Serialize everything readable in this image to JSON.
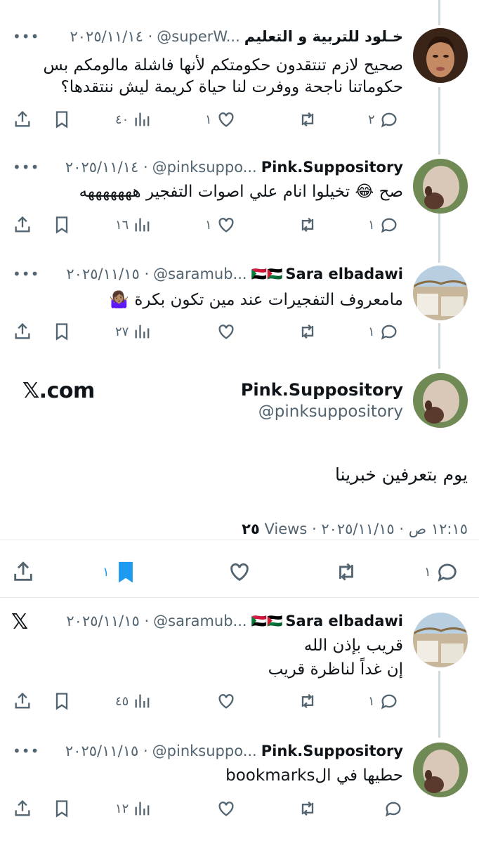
{
  "tweets": [
    {
      "name": "خـلود للتربية و التعليم",
      "handle": "@superW...",
      "date": "٢٠٢٥/١١/١٤ ·",
      "text": "صحيح لازم تنتقدون حكومتكم لأنها فاشلة مالومكم بس حكوماتنا ناجحة ووفرت لنا حياة كريمة ليش ننتقدها؟",
      "replies": "٢",
      "retweets": "",
      "likes": "١",
      "views": "٤٠"
    },
    {
      "name": "Pink.Suppository",
      "handle": "@pinksuppo...",
      "date": "٢٠٢٥/١١/١٤ ·",
      "text": "صح 😂 تخيلوا انام علي اصوات التفجير هههههههه",
      "replies": "١",
      "retweets": "",
      "likes": "١",
      "views": "١٦"
    },
    {
      "name": "Sara elbadawi",
      "flags": "🇸🇩🇵🇸",
      "handle": "@saramub...",
      "date": "٢٠٢٥/١١/١٥ ·",
      "text": "مامعروف التفجيرات عند مين تكون بكرة 🤷🏽‍♀️",
      "replies": "١",
      "retweets": "",
      "likes": "",
      "views": "٢٧"
    }
  ],
  "main": {
    "name": "Pink.Suppository",
    "handle": "@pinksuppository",
    "brand": "𝕏.com",
    "text": "يوم بتعرفين خبرينا",
    "datetime": "١٢:١٥ ص · ٢٠٢٥/١١/١٥ ·",
    "views_count": "٢٥",
    "views_label": "Views",
    "replies": "١",
    "bookmarks": "١"
  },
  "replies": [
    {
      "name": "Sara elbadawi",
      "flags": "🇸🇩🇵🇸",
      "handle": "@saramub...",
      "date": "٢٠٢٥/١١/١٥ ·",
      "text_line1": "قريب بإذن الله",
      "text_line2": "إن غداً لناظرة قريب",
      "replies": "١",
      "views": "٤٥"
    },
    {
      "name": "Pink.Suppository",
      "handle": "@pinksuppo...",
      "date": "٢٠٢٥/١١/١٥ ·",
      "text": "حطيها في الbookmarks",
      "views": "١٢"
    }
  ],
  "ui": {
    "more": "•••",
    "x_logo": "𝕏"
  },
  "colors": {
    "accent": "#1d9bf0",
    "muted": "#536471",
    "text": "#0f1419"
  },
  "icons": [
    "share-icon",
    "bookmark-icon",
    "views-icon",
    "like-icon",
    "retweet-icon",
    "reply-icon",
    "x-logo-icon"
  ]
}
